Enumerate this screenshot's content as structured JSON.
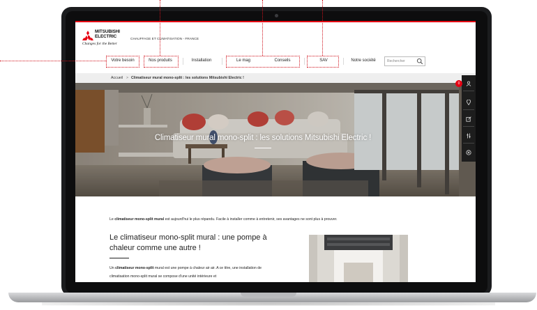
{
  "logo": {
    "brand_line1": "MITSUBISHI",
    "brand_line2": "ELECTRIC",
    "tagline": "Changes for the Better",
    "subtitle": "CHAUFFAGE ET CLIMATISATION - FRANCE"
  },
  "nav": {
    "items": [
      {
        "label": "Votre besoin"
      },
      {
        "label": "Nos produits"
      },
      {
        "label": "Installation"
      },
      {
        "label": "Le mag"
      },
      {
        "label": "Conseils"
      },
      {
        "label": "SAV"
      },
      {
        "label": "Notre société"
      }
    ],
    "search_placeholder": "Rechercher"
  },
  "breadcrumb": {
    "home": "Accueil",
    "separator": ">",
    "current": "Climatiseur mural mono-split : les solutions Mitsubishi Electric !"
  },
  "hero": {
    "title": "Climatiseur mural mono-split : les solutions Mitsubishi Electric !"
  },
  "side_rail": {
    "badge": "0",
    "icons": [
      "user-icon",
      "location-pin-icon",
      "edit-icon",
      "settings-sliders-icon",
      "close-circle-icon"
    ]
  },
  "content": {
    "intro_bold": "climatiseur mono-split mural",
    "intro_pre": "Le ",
    "intro_post": " est aujourd'hui le plus répandu. Facile à installer comme à entretenir, ses avantages ne sont plus à prouver.",
    "heading": "Le climatiseur mono-split mural : une pompe à chaleur comme une autre !",
    "p1_pre": "Un ",
    "p1_bold": "climatiseur mono-split",
    "p1_post": " mural est une pompe à chaleur air air. A ce titre, une installation de climatisation mono-split mural se compose d'une unité intérieure et"
  },
  "colors": {
    "brand_red": "#e60012",
    "callout_red": "#d0101a",
    "rail_dark": "#1d1d1d"
  }
}
